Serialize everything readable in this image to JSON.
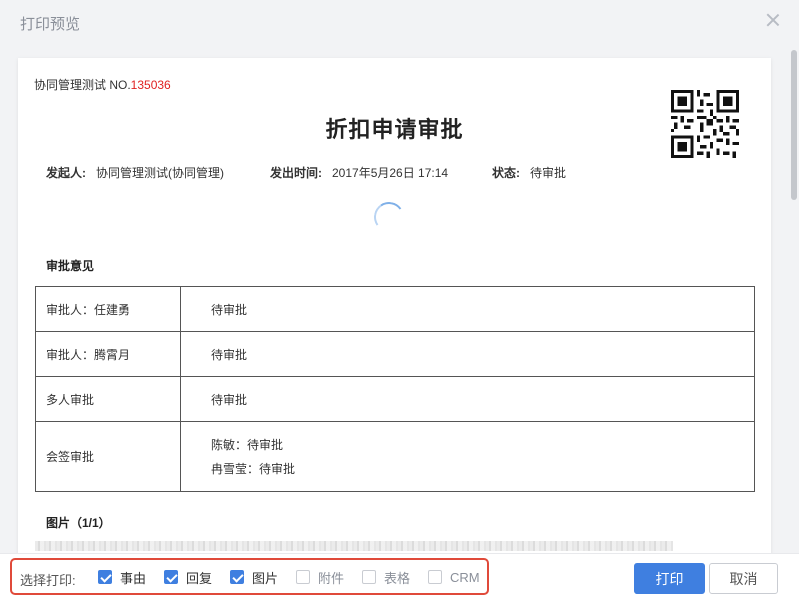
{
  "dialog": {
    "title": "打印预览"
  },
  "document": {
    "no_label": "协同管理测试 NO.",
    "no_value": "135036",
    "title": "折扣申请审批",
    "meta": {
      "initiator_label": "发起人:",
      "initiator_value": "协同管理测试(协同管理)",
      "sent_time_label": "发出时间:",
      "sent_time_value": "2017年5月26日 17:14",
      "status_label": "状态:",
      "status_value": "待审批"
    },
    "approval_section_title": "审批意见",
    "approvals": [
      {
        "who": "审批人：任建勇",
        "lines": [
          "待审批"
        ]
      },
      {
        "who": "审批人：腾霄月",
        "lines": [
          "待审批"
        ]
      },
      {
        "who": "多人审批",
        "lines": [
          "待审批"
        ]
      },
      {
        "who": "会签审批",
        "lines": [
          "陈敏：待审批",
          "冉雪莹：待审批"
        ]
      }
    ],
    "images_section_title": "图片（1/1）"
  },
  "footer": {
    "select_label": "选择打印:",
    "options": [
      {
        "label": "事由",
        "checked": true
      },
      {
        "label": "回复",
        "checked": true
      },
      {
        "label": "图片",
        "checked": true
      },
      {
        "label": "附件",
        "checked": false
      },
      {
        "label": "表格",
        "checked": false
      },
      {
        "label": "CRM",
        "checked": false
      }
    ],
    "print_label": "打印",
    "cancel_label": "取消"
  },
  "colors": {
    "accent": "#3f7fe0",
    "highlight_box": "#e04a3a",
    "doc_no": "#e02020"
  }
}
